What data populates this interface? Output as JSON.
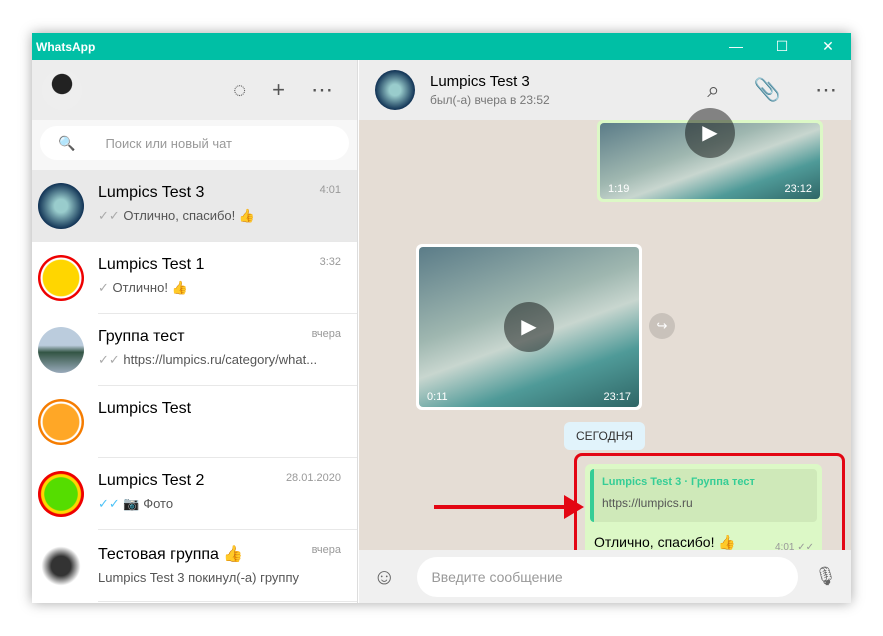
{
  "app": {
    "title": "WhatsApp",
    "minimize": "—",
    "maximize": "☐",
    "close": "✕"
  },
  "sidebar": {
    "icons": {
      "status": "◌",
      "new_chat": "+",
      "menu": "⋯"
    },
    "search_placeholder": "Поиск или новый чат",
    "chats": [
      {
        "name": "Lumpics Test 3",
        "time": "4:01",
        "check": "✓✓",
        "preview": "Отлично, спасибо! 👍"
      },
      {
        "name": "Lumpics Test 1",
        "time": "3:32",
        "check": "✓",
        "preview": "Отлично! 👍"
      },
      {
        "name": "Группа тест",
        "time": "вчера",
        "check": "✓✓",
        "preview": "https://lumpics.ru/category/what..."
      },
      {
        "name": "Lumpics Test",
        "time": "",
        "check": "",
        "preview": ""
      },
      {
        "name": "Lumpics Test 2",
        "time": "28.01.2020",
        "check": "✓✓",
        "preview": "📷 Фото"
      },
      {
        "name": "Тестовая группа 👍",
        "time": "вчера",
        "check": "",
        "preview": "Lumpics Test 3 покинул(-а) группу"
      }
    ]
  },
  "chat": {
    "name": "Lumpics Test 3",
    "status": "был(-а) вчера в 23:52",
    "videos": [
      {
        "duration": "1:19",
        "time": "23:12"
      },
      {
        "duration": "0:11",
        "time": "23:17"
      }
    ],
    "date_divider": "СЕГОДНЯ",
    "message": {
      "quote_title": "Lumpics Test 3 · Группа тест",
      "quote_text": "https://lumpics.ru",
      "text": "Отлично, спасибо! 👍",
      "time": "4:01 ✓✓"
    },
    "input_placeholder": "Введите сообщение"
  }
}
